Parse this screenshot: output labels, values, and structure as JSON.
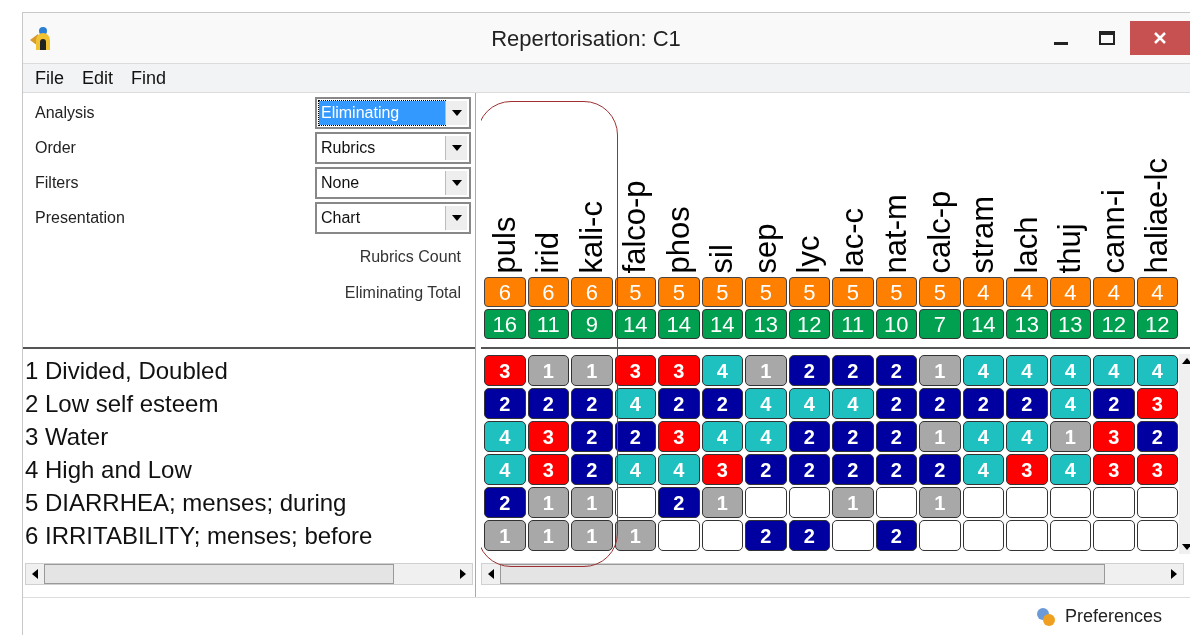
{
  "window": {
    "title": "Repertorisation: C1"
  },
  "menu": [
    "File",
    "Edit",
    "Find"
  ],
  "settings": [
    {
      "label": "Analysis",
      "value": "Eliminating",
      "focused": true
    },
    {
      "label": "Order",
      "value": "Rubrics",
      "focused": false
    },
    {
      "label": "Filters",
      "value": "None",
      "focused": false
    },
    {
      "label": "Presentation",
      "value": "Chart",
      "focused": false
    }
  ],
  "summary_labels": [
    "Rubrics Count",
    "Eliminating Total"
  ],
  "columns": [
    {
      "name": "puls",
      "count": "6",
      "total": "16",
      "highlighted": true
    },
    {
      "name": "irid",
      "count": "6",
      "total": "11",
      "highlighted": true
    },
    {
      "name": "kali-c",
      "count": "6",
      "total": "9",
      "highlighted": true
    },
    {
      "name": "falco-p",
      "count": "5",
      "total": "14",
      "highlighted": false
    },
    {
      "name": "phos",
      "count": "5",
      "total": "14",
      "highlighted": false
    },
    {
      "name": "sil",
      "count": "5",
      "total": "14",
      "highlighted": false
    },
    {
      "name": "sep",
      "count": "5",
      "total": "13",
      "highlighted": false
    },
    {
      "name": "lyc",
      "count": "5",
      "total": "12",
      "highlighted": false
    },
    {
      "name": "lac-c",
      "count": "5",
      "total": "11",
      "highlighted": false
    },
    {
      "name": "nat-m",
      "count": "5",
      "total": "10",
      "highlighted": false
    },
    {
      "name": "calc-p",
      "count": "5",
      "total": "7",
      "highlighted": false
    },
    {
      "name": "stram",
      "count": "4",
      "total": "14",
      "highlighted": false
    },
    {
      "name": "lach",
      "count": "4",
      "total": "13",
      "highlighted": false
    },
    {
      "name": "thuj",
      "count": "4",
      "total": "13",
      "highlighted": false
    },
    {
      "name": "cann-i",
      "count": "4",
      "total": "12",
      "highlighted": false
    },
    {
      "name": "haliae-lc",
      "count": "4",
      "total": "12",
      "highlighted": false
    }
  ],
  "rubrics": [
    {
      "label": "1 Divided, Doubled",
      "cells": [
        {
          "empty": false,
          "grade": "3"
        },
        {
          "empty": false,
          "grade": "1"
        },
        {
          "empty": false,
          "grade": "1"
        },
        {
          "empty": false,
          "grade": "3"
        },
        {
          "empty": false,
          "grade": "3"
        },
        {
          "empty": false,
          "grade": "4"
        },
        {
          "empty": false,
          "grade": "1"
        },
        {
          "empty": false,
          "grade": "2"
        },
        {
          "empty": false,
          "grade": "2"
        },
        {
          "empty": false,
          "grade": "2"
        },
        {
          "empty": false,
          "grade": "1"
        },
        {
          "empty": false,
          "grade": "4"
        },
        {
          "empty": false,
          "grade": "4"
        },
        {
          "empty": false,
          "grade": "4"
        },
        {
          "empty": false,
          "grade": "4"
        },
        {
          "empty": false,
          "grade": "4"
        }
      ]
    },
    {
      "label": "2 Low self esteem",
      "cells": [
        {
          "empty": false,
          "grade": "2"
        },
        {
          "empty": false,
          "grade": "2"
        },
        {
          "empty": false,
          "grade": "2"
        },
        {
          "empty": false,
          "grade": "4"
        },
        {
          "empty": false,
          "grade": "2"
        },
        {
          "empty": false,
          "grade": "2"
        },
        {
          "empty": false,
          "grade": "4"
        },
        {
          "empty": false,
          "grade": "4"
        },
        {
          "empty": false,
          "grade": "4"
        },
        {
          "empty": false,
          "grade": "2"
        },
        {
          "empty": false,
          "grade": "2"
        },
        {
          "empty": false,
          "grade": "2"
        },
        {
          "empty": false,
          "grade": "2"
        },
        {
          "empty": false,
          "grade": "4"
        },
        {
          "empty": false,
          "grade": "2"
        },
        {
          "empty": false,
          "grade": "3"
        }
      ]
    },
    {
      "label": "3 Water",
      "cells": [
        {
          "empty": false,
          "grade": "4"
        },
        {
          "empty": false,
          "grade": "3"
        },
        {
          "empty": false,
          "grade": "2"
        },
        {
          "empty": false,
          "grade": "2"
        },
        {
          "empty": false,
          "grade": "3"
        },
        {
          "empty": false,
          "grade": "4"
        },
        {
          "empty": false,
          "grade": "4"
        },
        {
          "empty": false,
          "grade": "2"
        },
        {
          "empty": false,
          "grade": "2"
        },
        {
          "empty": false,
          "grade": "2"
        },
        {
          "empty": false,
          "grade": "1"
        },
        {
          "empty": false,
          "grade": "4"
        },
        {
          "empty": false,
          "grade": "4"
        },
        {
          "empty": false,
          "grade": "1"
        },
        {
          "empty": false,
          "grade": "3"
        },
        {
          "empty": false,
          "grade": "2"
        }
      ]
    },
    {
      "label": "4 High and Low",
      "cells": [
        {
          "empty": false,
          "grade": "4"
        },
        {
          "empty": false,
          "grade": "3"
        },
        {
          "empty": false,
          "grade": "2"
        },
        {
          "empty": false,
          "grade": "4"
        },
        {
          "empty": false,
          "grade": "4"
        },
        {
          "empty": false,
          "grade": "3"
        },
        {
          "empty": false,
          "grade": "2"
        },
        {
          "empty": false,
          "grade": "2"
        },
        {
          "empty": false,
          "grade": "2"
        },
        {
          "empty": false,
          "grade": "2"
        },
        {
          "empty": false,
          "grade": "2"
        },
        {
          "empty": false,
          "grade": "4"
        },
        {
          "empty": false,
          "grade": "3"
        },
        {
          "empty": false,
          "grade": "4"
        },
        {
          "empty": false,
          "grade": "3"
        },
        {
          "empty": false,
          "grade": "3"
        }
      ]
    },
    {
      "label": "5 DIARRHEA; menses; during",
      "cells": [
        {
          "empty": false,
          "grade": "2"
        },
        {
          "empty": false,
          "grade": "1"
        },
        {
          "empty": false,
          "grade": "1"
        },
        {
          "empty": true
        },
        {
          "empty": false,
          "grade": "2"
        },
        {
          "empty": false,
          "grade": "1"
        },
        {
          "empty": true
        },
        {
          "empty": true
        },
        {
          "empty": false,
          "grade": "1"
        },
        {
          "empty": true
        },
        {
          "empty": false,
          "grade": "1"
        },
        {
          "empty": true
        },
        {
          "empty": true
        },
        {
          "empty": true
        },
        {
          "empty": true
        },
        {
          "empty": true
        }
      ]
    },
    {
      "label": "6 IRRITABILITY; menses; before",
      "cells": [
        {
          "empty": false,
          "grade": "1"
        },
        {
          "empty": false,
          "grade": "1"
        },
        {
          "empty": false,
          "grade": "1"
        },
        {
          "empty": false,
          "grade": "1"
        },
        {
          "empty": true
        },
        {
          "empty": true
        },
        {
          "empty": false,
          "grade": "2"
        },
        {
          "empty": false,
          "grade": "2"
        },
        {
          "empty": true
        },
        {
          "empty": false,
          "grade": "2"
        },
        {
          "empty": true
        },
        {
          "empty": true
        },
        {
          "empty": true
        },
        {
          "empty": true
        },
        {
          "empty": true
        },
        {
          "empty": true
        }
      ]
    }
  ],
  "status_bar": {
    "button": "Preferences"
  }
}
